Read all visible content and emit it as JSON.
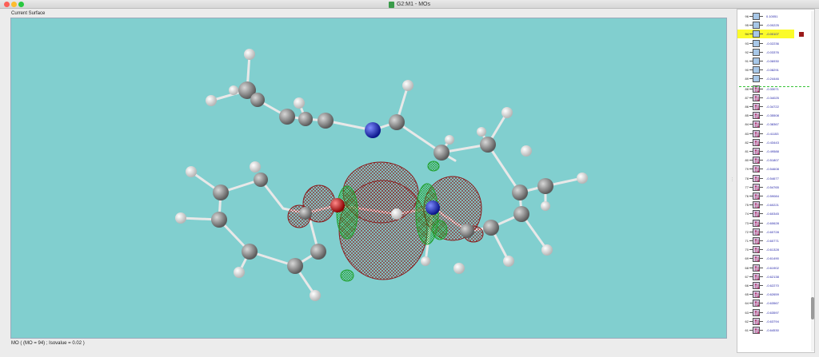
{
  "window": {
    "title": "G2:M1 - MOs"
  },
  "surface_label": "Current Surface",
  "status_text": "MO ( (MO = 94) ; Isovalue = 0.02 )",
  "mo_list": [
    {
      "num": "96",
      "energy": "0.10051",
      "occ": false
    },
    {
      "num": "95",
      "energy": "-0.00225",
      "occ": false
    },
    {
      "num": "94",
      "energy": "-0.00107",
      "occ": false,
      "selected": true
    },
    {
      "num": "93",
      "energy": "-0.02236",
      "occ": false
    },
    {
      "num": "92",
      "energy": "-0.03376",
      "occ": false
    },
    {
      "num": "91",
      "energy": "-0.06930",
      "occ": false
    },
    {
      "num": "90",
      "energy": "-0.08291",
      "occ": false
    },
    {
      "num": "89",
      "energy": "-0.24446",
      "occ": false
    },
    {
      "num": "88",
      "energy": "-0.33071",
      "occ": true
    },
    {
      "num": "87",
      "energy": "-0.34025",
      "occ": true
    },
    {
      "num": "86",
      "energy": "-0.34722",
      "occ": true
    },
    {
      "num": "85",
      "energy": "-0.35508",
      "occ": true
    },
    {
      "num": "84",
      "energy": "-0.38367",
      "occ": true
    },
    {
      "num": "83",
      "energy": "-0.41153",
      "occ": true
    },
    {
      "num": "82",
      "energy": "-0.43443",
      "occ": true
    },
    {
      "num": "81",
      "energy": "-0.49588",
      "occ": true
    },
    {
      "num": "80",
      "energy": "-0.51807",
      "occ": true
    },
    {
      "num": "79",
      "energy": "-0.54608",
      "occ": true
    },
    {
      "num": "78",
      "energy": "-0.54677",
      "occ": true
    },
    {
      "num": "77",
      "energy": "-0.54765",
      "occ": true
    },
    {
      "num": "76",
      "energy": "-0.59084",
      "occ": true
    },
    {
      "num": "75",
      "energy": "-0.60221",
      "occ": true
    },
    {
      "num": "74",
      "energy": "-0.60345",
      "occ": true
    },
    {
      "num": "73",
      "energy": "-0.60628",
      "occ": true
    },
    {
      "num": "72",
      "energy": "-0.60728",
      "occ": true
    },
    {
      "num": "71",
      "energy": "-0.60771",
      "occ": true
    },
    {
      "num": "70",
      "energy": "-0.61328",
      "occ": true
    },
    {
      "num": "69",
      "energy": "-0.61490",
      "occ": true
    },
    {
      "num": "68",
      "energy": "-0.61902",
      "occ": true
    },
    {
      "num": "67",
      "energy": "-0.62138",
      "occ": true
    },
    {
      "num": "66",
      "energy": "-0.62270",
      "occ": true
    },
    {
      "num": "65",
      "energy": "-0.62659",
      "occ": true
    },
    {
      "num": "64",
      "energy": "-0.63567",
      "occ": true
    },
    {
      "num": "63",
      "energy": "-0.63597",
      "occ": true
    },
    {
      "num": "62",
      "energy": "-0.63794",
      "occ": true
    },
    {
      "num": "61",
      "energy": "-0.64530",
      "occ": true
    }
  ],
  "colors": {
    "viewport_bg": "#81cfcf",
    "orbital_positive": "#8b1a1a",
    "orbital_negative": "#1fa02a",
    "carbon": "#7d7d7d",
    "hydrogen": "#e6e6e6",
    "nitrogen": "#1b2fd6",
    "oxygen": "#e01010",
    "selection": "#fbfb2a"
  }
}
